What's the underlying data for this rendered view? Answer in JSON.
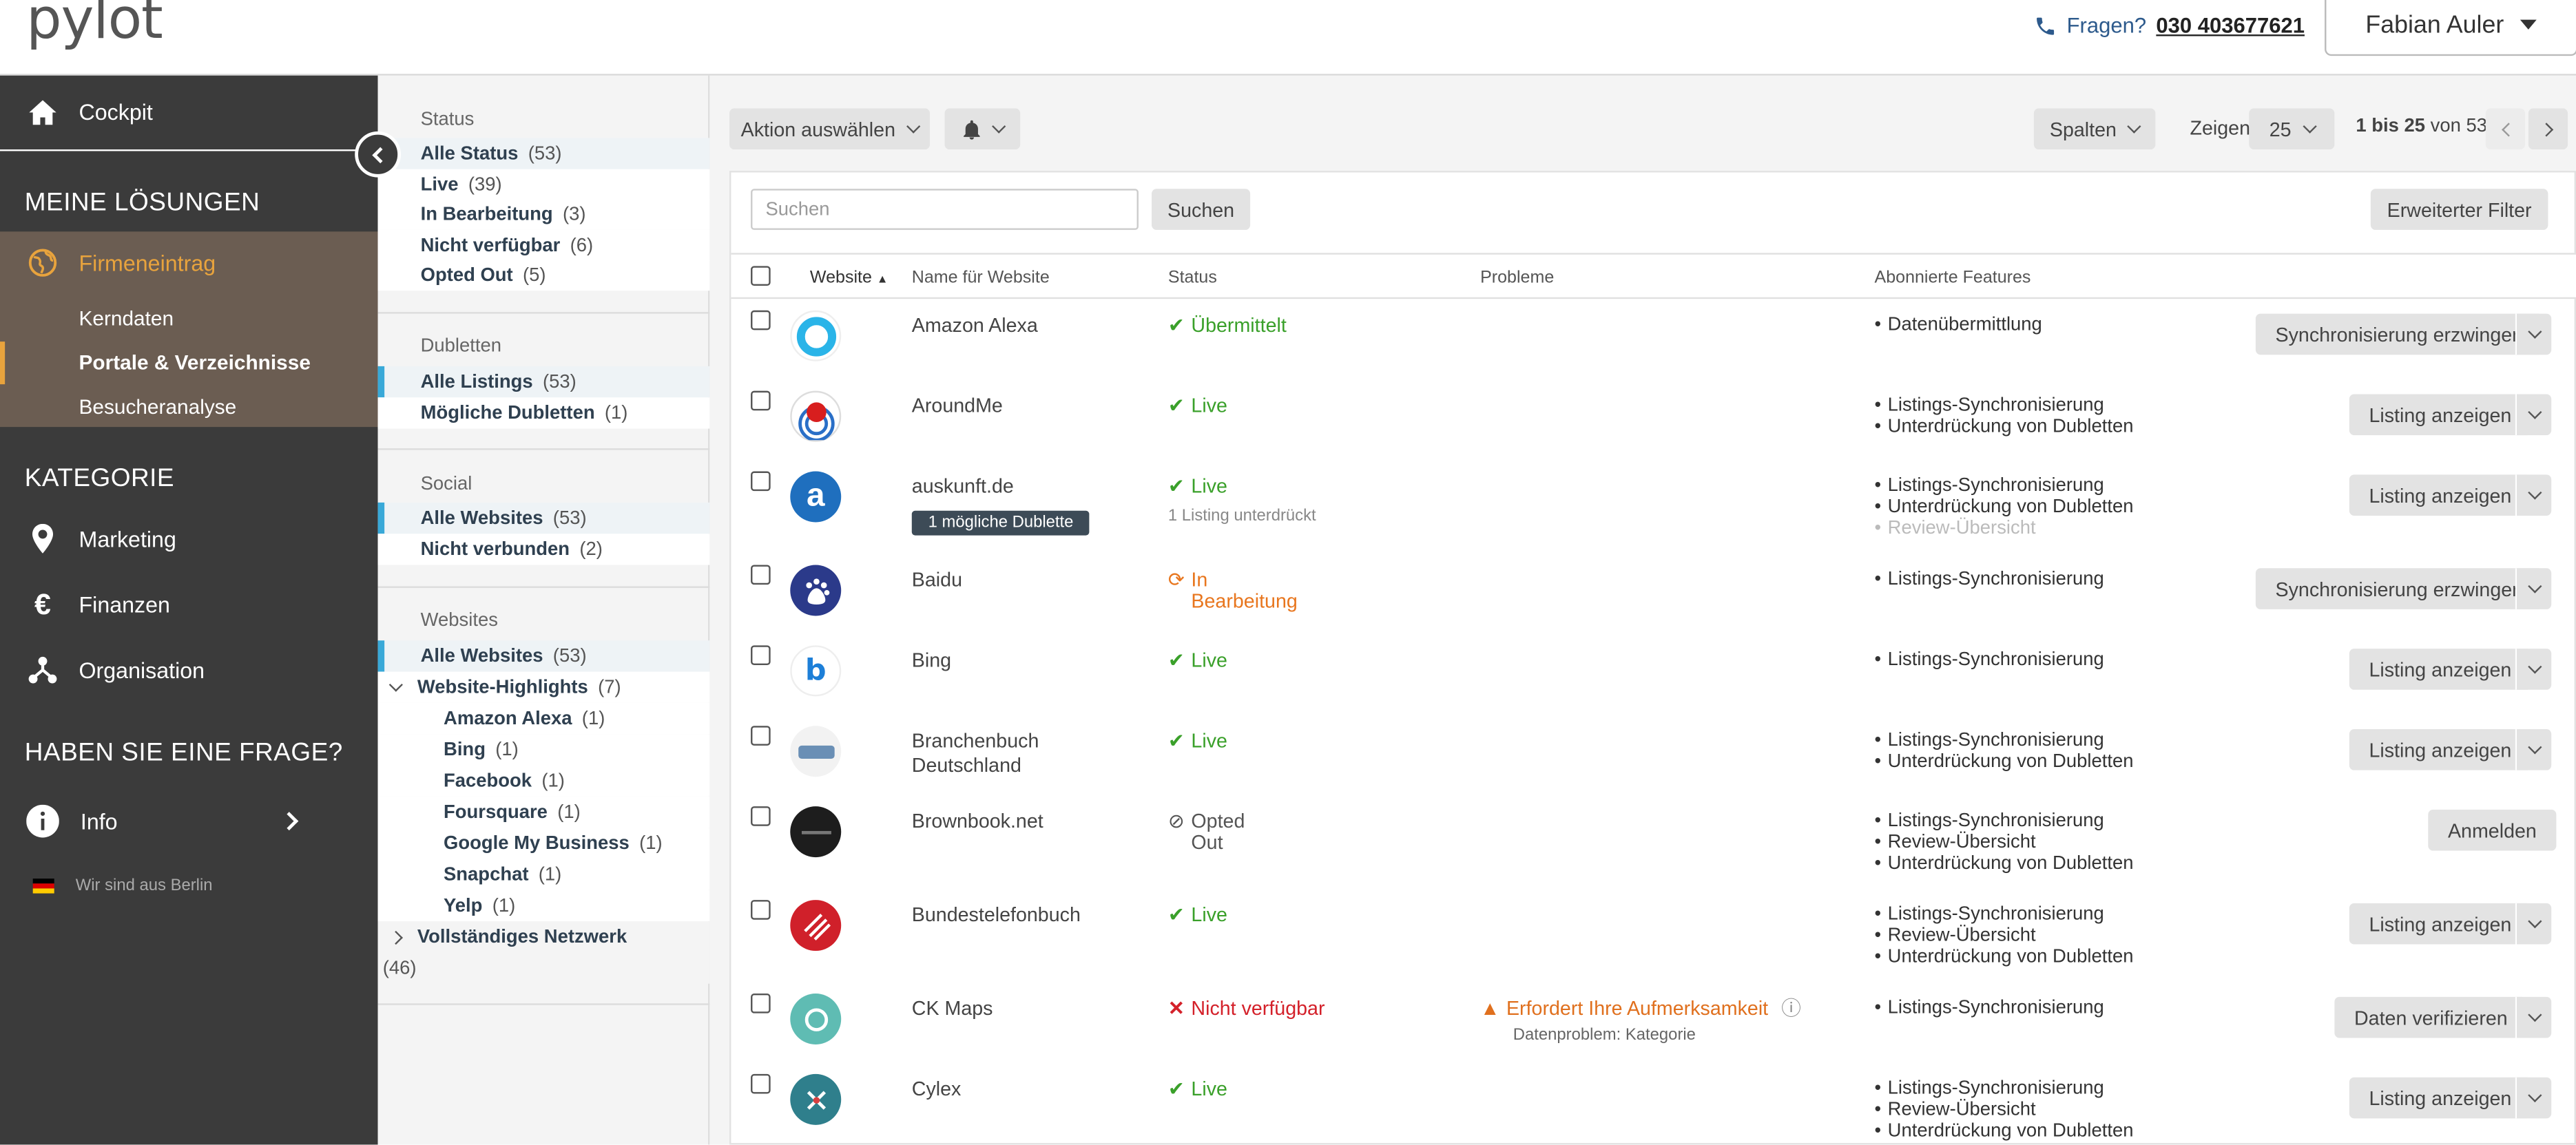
{
  "header": {
    "logo": "pylot",
    "phone_prefix": "Fragen?",
    "phone_number": "030 403677621",
    "user_name": "Fabian Auler"
  },
  "sidebar": {
    "cockpit": "Cockpit",
    "section_solutions": "MEINE LÖSUNGEN",
    "firmeneintrag": "Firmeneintrag",
    "sub_items": [
      "Kerndaten",
      "Portale & Verzeichnisse",
      "Besucheranalyse"
    ],
    "section_category": "KATEGORIE",
    "category_items": [
      "Marketing",
      "Finanzen",
      "Organisation"
    ],
    "section_question": "HABEN SIE EINE FRAGE?",
    "info": "Info",
    "berlin": "Wir sind aus Berlin"
  },
  "filters": {
    "status": {
      "title": "Status",
      "items": [
        {
          "name": "Alle Status",
          "count": "(53)"
        },
        {
          "name": "Live",
          "count": "(39)"
        },
        {
          "name": "In Bearbeitung",
          "count": "(3)"
        },
        {
          "name": "Nicht verfügbar",
          "count": "(6)"
        },
        {
          "name": "Opted Out",
          "count": "(5)"
        }
      ]
    },
    "duplicates": {
      "title": "Dubletten",
      "items": [
        {
          "name": "Alle Listings",
          "count": "(53)"
        },
        {
          "name": "Mögliche Dubletten",
          "count": "(1)"
        }
      ]
    },
    "social": {
      "title": "Social",
      "items": [
        {
          "name": "Alle Websites",
          "count": "(53)"
        },
        {
          "name": "Nicht verbunden",
          "count": "(2)"
        }
      ]
    },
    "websites": {
      "title": "Websites",
      "all": {
        "name": "Alle Websites",
        "count": "(53)"
      },
      "highlights": {
        "name": "Website-Highlights",
        "count": "(7)"
      },
      "highlight_items": [
        {
          "name": "Amazon Alexa",
          "count": "(1)"
        },
        {
          "name": "Bing",
          "count": "(1)"
        },
        {
          "name": "Facebook",
          "count": "(1)"
        },
        {
          "name": "Foursquare",
          "count": "(1)"
        },
        {
          "name": "Google My Business",
          "count": "(1)"
        },
        {
          "name": "Snapchat",
          "count": "(1)"
        },
        {
          "name": "Yelp",
          "count": "(1)"
        }
      ],
      "network": {
        "name": "Vollständiges Netzwerk",
        "count": "(46)"
      }
    }
  },
  "toolbar": {
    "action": "Aktion auswählen",
    "columns": "Spalten",
    "show_label": "Zeigen",
    "page_size": "25",
    "range": "1 bis 25",
    "of": "von 53"
  },
  "search": {
    "placeholder": "Suchen",
    "button": "Suchen",
    "advanced": "Erweiterter Filter"
  },
  "table": {
    "headers": [
      "Website",
      "Name für Website",
      "Status",
      "Probleme",
      "Abonnierte Features"
    ],
    "rows": [
      {
        "name": "Amazon Alexa",
        "status": "Übermittelt",
        "features": [
          "Datenübermittlung"
        ],
        "action": "Synchronisierung erzwingen"
      },
      {
        "name": "AroundMe",
        "status": "Live",
        "features": [
          "Listings-Synchronisierung",
          "Unterdrückung von Dubletten"
        ],
        "action": "Listing anzeigen"
      },
      {
        "name": "auskunft.de",
        "badge": "1 mögliche Dublette",
        "status": "Live",
        "status_note": "1 Listing unterdrückt",
        "features": [
          "Listings-Synchronisierung",
          "Unterdrückung von Dubletten",
          "Review-Übersicht"
        ],
        "action": "Listing anzeigen"
      },
      {
        "name": "Baidu",
        "status_line1": "In",
        "status_line2": "Bearbeitung",
        "features": [
          "Listings-Synchronisierung"
        ],
        "action": "Synchronisierung erzwingen"
      },
      {
        "name": "Bing",
        "status": "Live",
        "features": [
          "Listings-Synchronisierung"
        ],
        "action": "Listing anzeigen"
      },
      {
        "name_line1": "Branchenbuch",
        "name_line2": "Deutschland",
        "status": "Live",
        "features": [
          "Listings-Synchronisierung",
          "Unterdrückung von Dubletten"
        ],
        "action": "Listing anzeigen"
      },
      {
        "name": "Brownbook.net",
        "status_line1": "Opted",
        "status_line2": "Out",
        "features": [
          "Listings-Synchronisierung",
          "Review-Übersicht",
          "Unterdrückung von Dubletten"
        ],
        "action": "Anmelden"
      },
      {
        "name": "Bundestelefonbuch",
        "status": "Live",
        "features": [
          "Listings-Synchronisierung",
          "Review-Übersicht",
          "Unterdrückung von Dubletten"
        ],
        "action": "Listing anzeigen"
      },
      {
        "name": "CK Maps",
        "status": "Nicht verfügbar",
        "problem": "Erfordert Ihre Aufmerksamkeit",
        "problem_note": "Datenproblem: Kategorie",
        "features": [
          "Listings-Synchronisierung"
        ],
        "action": "Daten verifizieren"
      },
      {
        "name": "Cylex",
        "status": "Live",
        "features": [
          "Listings-Synchronisierung",
          "Review-Übersicht",
          "Unterdrückung von Dubletten"
        ],
        "action": "Listing anzeigen"
      }
    ]
  },
  "colors": {
    "sidebar_bg": "#3b3b3b",
    "accent_orange": "#e8a33d",
    "live_green": "#3aa02a",
    "error_red": "#d4212a",
    "processing_orange": "#e8761e",
    "select_blue": "#39a9d8"
  }
}
